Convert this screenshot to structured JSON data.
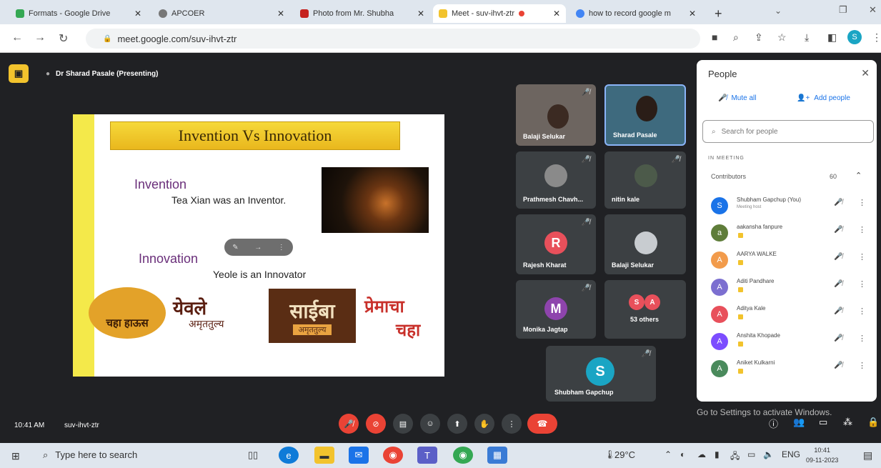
{
  "browser": {
    "tabs": [
      {
        "title": "Formats - Google Drive",
        "active": false,
        "color": "#34a853"
      },
      {
        "title": "APCOER",
        "active": false,
        "color": "#777777"
      },
      {
        "title": "Photo from Mr. Shubha",
        "active": false,
        "color": "#c5221f"
      },
      {
        "title": "Meet - suv-ihvt-ztr",
        "active": true,
        "color": "#f2c32d"
      },
      {
        "title": "how to record google m",
        "active": false,
        "color": "#4285f4"
      }
    ],
    "new_tab": "+",
    "url": "meet.google.com/suv-ihvt-ztr"
  },
  "meet": {
    "presenter": "Dr Sharad Pasale (Presenting)",
    "slide": {
      "title": "Invention Vs Innovation",
      "invention_heading": "Invention",
      "invention_text": "Tea   Xian was an Inventor.",
      "innovation_heading": "Innovation",
      "innovation_text": "Yeole is an Innovator",
      "logos": [
        "चहा हाऊस",
        "येवले",
        "अमृततुल्य",
        "साईबा",
        "अमृततुल्य",
        "प्रेमाचा",
        "चहा"
      ]
    },
    "tiles": [
      {
        "name": "Balaji Selukar",
        "type": "video"
      },
      {
        "name": "Sharad Pasale",
        "type": "video"
      },
      {
        "name": "Prathmesh Chavh...",
        "type": "photo"
      },
      {
        "name": "nitin kale",
        "type": "photo"
      },
      {
        "name": "Rajesh Kharat",
        "type": "letter",
        "letter": "R",
        "color": "#e8505b"
      },
      {
        "name": "Balaji Selukar",
        "type": "photo"
      },
      {
        "name": "Monika Jagtap",
        "type": "letter",
        "letter": "M",
        "color": "#8e44ad"
      },
      {
        "name": "53 others",
        "type": "others",
        "color": "#e8505b"
      },
      {
        "name": "Shubham Gapchup",
        "type": "letter",
        "letter": "S",
        "color": "#1aa5c4"
      }
    ],
    "meeting_time": "10:41 AM",
    "meeting_code": "suv-ihvt-ztr"
  },
  "people": {
    "title": "People",
    "mute_all": "Mute all",
    "add_people": "Add people",
    "search_placeholder": "Search for people",
    "in_meeting": "IN MEETING",
    "contributors_label": "Contributors",
    "contributors_count": "60",
    "list": [
      {
        "name": "Shubham Gapchup (You)",
        "sub": "Meeting host",
        "initial": "S",
        "color": "#1a73e8"
      },
      {
        "name": "aakansha fanpure",
        "initial": "a",
        "color": "#5f7d3a"
      },
      {
        "name": "AARYA WALKE",
        "initial": "A",
        "color": "#f29b4b"
      },
      {
        "name": "Aditi Pandhare",
        "initial": "A",
        "color": "#7c6fd0"
      },
      {
        "name": "Aditya Kale",
        "initial": "A",
        "color": "#e8505b"
      },
      {
        "name": "Anshita Khopade",
        "initial": "A",
        "color": "#7c4dff"
      },
      {
        "name": "Aniket Kulkarni",
        "initial": "A",
        "color": "#4a8a5c"
      }
    ]
  },
  "watermark": "Go to Settings to activate Windows.",
  "taskbar": {
    "search": "Type here to search",
    "temperature": "29°C",
    "language": "ENG",
    "time": "10:41",
    "date": "09-11-2023"
  }
}
